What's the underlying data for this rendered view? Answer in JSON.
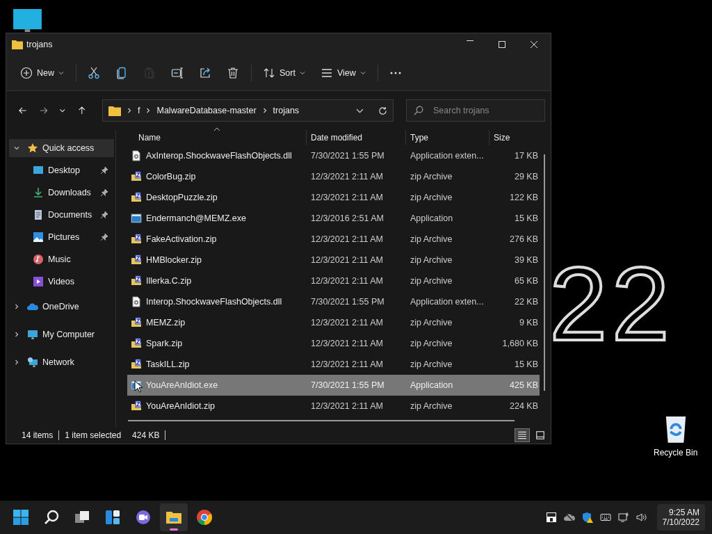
{
  "desktop": {
    "wallpaper_text": "22",
    "icons": [
      {
        "kind": "computer"
      },
      {
        "kind": "recycle",
        "label": "Recycle Bin"
      }
    ]
  },
  "window": {
    "title": "trojans"
  },
  "toolbar": [
    {
      "kind": "new",
      "label": "New",
      "disabled": false
    },
    {
      "kind": "cut",
      "disabled": false
    },
    {
      "kind": "copy",
      "disabled": false
    },
    {
      "kind": "paste",
      "disabled": true
    },
    {
      "kind": "rename",
      "disabled": false
    },
    {
      "kind": "share",
      "disabled": false
    },
    {
      "kind": "delete",
      "disabled": false
    },
    {
      "kind": "sort",
      "label": "Sort",
      "disabled": false
    },
    {
      "kind": "view",
      "label": "View",
      "disabled": false
    },
    {
      "kind": "more",
      "disabled": false
    }
  ],
  "address": {
    "segments": [
      "f",
      "MalwareDatabase-master",
      "trojans"
    ],
    "search_placeholder": "Search trojans"
  },
  "sidebar": {
    "items": [
      {
        "kind": "star",
        "label": "Quick access",
        "expanded": true,
        "selected": true,
        "children": [
          {
            "kind": "desktop",
            "label": "Desktop",
            "pinned": true,
            "selected": false
          },
          {
            "kind": "downloads",
            "label": "Downloads",
            "pinned": true,
            "selected": false
          },
          {
            "kind": "documents",
            "label": "Documents",
            "pinned": true,
            "selected": false
          },
          {
            "kind": "pictures",
            "label": "Pictures",
            "pinned": true,
            "selected": false
          },
          {
            "kind": "music",
            "label": "Music",
            "pinned": false,
            "selected": false
          },
          {
            "kind": "videos",
            "label": "Videos",
            "pinned": false,
            "selected": false
          }
        ]
      },
      {
        "kind": "onedrive",
        "label": "OneDrive",
        "expanded": false,
        "selected": false
      },
      {
        "kind": "computer",
        "label": "My Computer",
        "expanded": false,
        "selected": false
      },
      {
        "kind": "network",
        "label": "Network",
        "expanded": false,
        "selected": false
      }
    ]
  },
  "table": {
    "columns": [
      {
        "label": "Name",
        "sorted": true
      },
      {
        "label": "Date modified",
        "sorted": false
      },
      {
        "label": "Type",
        "sorted": false
      },
      {
        "label": "Size",
        "sorted": false
      }
    ],
    "rows": [
      {
        "kind": "dll",
        "name": "AxInterop.ShockwaveFlashObjects.dll",
        "date": "7/30/2021 1:55 PM",
        "type": "Application exten...",
        "size": "17 KB",
        "selected": false
      },
      {
        "kind": "zip",
        "name": "ColorBug.zip",
        "date": "12/3/2021 2:11 AM",
        "type": "zip Archive",
        "size": "29 KB",
        "selected": false
      },
      {
        "kind": "zip",
        "name": "DesktopPuzzle.zip",
        "date": "12/3/2021 2:11 AM",
        "type": "zip Archive",
        "size": "122 KB",
        "selected": false
      },
      {
        "kind": "exe",
        "name": "Endermanch@MEMZ.exe",
        "date": "12/3/2016 2:51 AM",
        "type": "Application",
        "size": "15 KB",
        "selected": false
      },
      {
        "kind": "zip",
        "name": "FakeActivation.zip",
        "date": "12/3/2021 2:11 AM",
        "type": "zip Archive",
        "size": "276 KB",
        "selected": false
      },
      {
        "kind": "zip",
        "name": "HMBlocker.zip",
        "date": "12/3/2021 2:11 AM",
        "type": "zip Archive",
        "size": "39 KB",
        "selected": false
      },
      {
        "kind": "zip",
        "name": "Illerka.C.zip",
        "date": "12/3/2021 2:11 AM",
        "type": "zip Archive",
        "size": "65 KB",
        "selected": false
      },
      {
        "kind": "dll",
        "name": "Interop.ShockwaveFlashObjects.dll",
        "date": "7/30/2021 1:55 PM",
        "type": "Application exten...",
        "size": "22 KB",
        "selected": false
      },
      {
        "kind": "zip",
        "name": "MEMZ.zip",
        "date": "12/3/2021 2:11 AM",
        "type": "zip Archive",
        "size": "9 KB",
        "selected": false
      },
      {
        "kind": "zip",
        "name": "Spark.zip",
        "date": "12/3/2021 2:11 AM",
        "type": "zip Archive",
        "size": "1,680 KB",
        "selected": false
      },
      {
        "kind": "zip",
        "name": "TaskILL.zip",
        "date": "12/3/2021 2:11 AM",
        "type": "zip Archive",
        "size": "15 KB",
        "selected": false
      },
      {
        "kind": "exe",
        "name": "YouAreAnIdiot.exe",
        "date": "7/30/2021 1:55 PM",
        "type": "Application",
        "size": "425 KB",
        "selected": true
      },
      {
        "kind": "zip",
        "name": "YouAreAnIdiot.zip",
        "date": "12/3/2021 2:11 AM",
        "type": "zip Archive",
        "size": "224 KB",
        "selected": false
      }
    ]
  },
  "status_bar": {
    "count": "14 items",
    "selection": "1 item selected",
    "selection_size": "424 KB",
    "views": [
      {
        "kind": "details",
        "selected": true
      },
      {
        "kind": "tiles",
        "selected": false
      }
    ]
  },
  "taskbar": {
    "apps": [
      {
        "kind": "start",
        "active": false
      },
      {
        "kind": "search",
        "active": false
      },
      {
        "kind": "taskview",
        "active": false
      },
      {
        "kind": "widgets",
        "active": false
      },
      {
        "kind": "chat",
        "active": false
      },
      {
        "kind": "explorer",
        "active": true
      },
      {
        "kind": "browser",
        "active": false
      }
    ],
    "tray": [
      {
        "kind": "hfs"
      },
      {
        "kind": "cloud-off"
      },
      {
        "kind": "shield"
      },
      {
        "kind": "keyboard"
      },
      {
        "kind": "network"
      },
      {
        "kind": "volume"
      }
    ],
    "time": "9:25 AM",
    "date": "7/10/2022"
  }
}
